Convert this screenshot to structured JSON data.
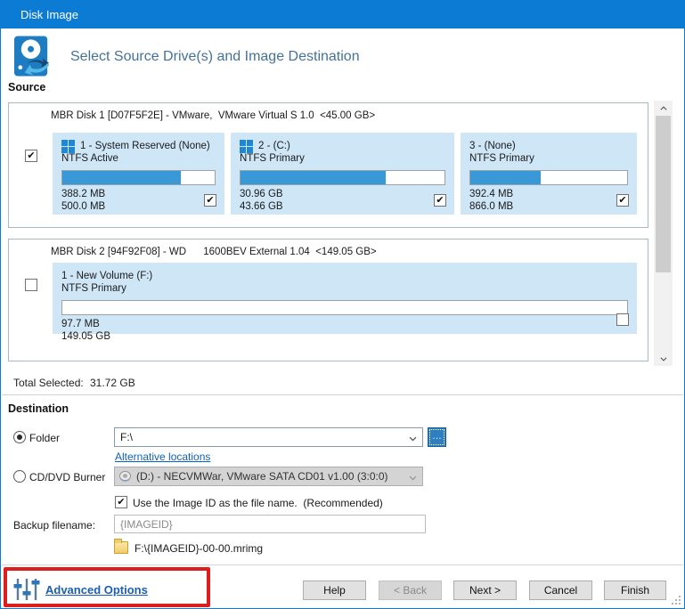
{
  "window": {
    "title": "Disk Image"
  },
  "header": {
    "title": "Select Source Drive(s) and Image Destination",
    "section_label": "Source"
  },
  "source": {
    "disks": [
      {
        "label": "MBR Disk 1 [D07F5F2E] - VMware,  VMware Virtual S 1.0  <45.00 GB>",
        "check": "✔",
        "partitions": [
          {
            "title": "1 - System Reserved (None)",
            "fs": "NTFS Active",
            "used": "388.2 MB",
            "total": "500.0 MB",
            "fill_pct": 78,
            "check": "✔"
          },
          {
            "title": "2 - (C:)",
            "fs": "NTFS Primary",
            "used": "30.96 GB",
            "total": "43.66 GB",
            "fill_pct": 71,
            "check": "✔"
          },
          {
            "title": "3 - (None)",
            "fs": "NTFS Primary",
            "used": "392.4 MB",
            "total": "866.0 MB",
            "fill_pct": 45,
            "check": "✔"
          }
        ]
      },
      {
        "label": "MBR Disk 2 [94F92F08] - WD      1600BEV External 1.04  <149.05 GB>",
        "check": "",
        "partitions": [
          {
            "title": "1 - New Volume (F:)",
            "fs": "NTFS Primary",
            "used": "97.7 MB",
            "total": "149.05 GB",
            "fill_pct": 0,
            "check": ""
          }
        ]
      }
    ],
    "total_selected_label": "Total Selected:",
    "total_selected_value": "31.72 GB"
  },
  "destination": {
    "section_label": "Destination",
    "folder_radio_label": "Folder",
    "folder_path": "F:\\",
    "browse_label": "…",
    "alternative_locations_label": "Alternative locations",
    "cd_radio_label": "CD/DVD Burner",
    "cd_device": "(D:) - NECVMWar, VMware SATA CD01 v1.00 (3:0:0)",
    "use_image_id_label": "Use the Image ID as the file name.  (Recommended)",
    "backup_filename_label": "Backup filename:",
    "backup_filename_value": "{IMAGEID}",
    "full_path": "F:\\{IMAGEID}-00-00.mrimg"
  },
  "footer": {
    "advanced_options_label": "Advanced Options",
    "buttons": {
      "help": "Help",
      "back": "< Back",
      "next": "Next >",
      "cancel": "Cancel",
      "finish": "Finish"
    }
  },
  "colors": {
    "titlebar": "#0c7bd3",
    "partition_card_bg": "#cfe6f7",
    "bar_fill": "#3899d6",
    "link": "#0e62b9",
    "highlight_red": "#e01d1d"
  }
}
